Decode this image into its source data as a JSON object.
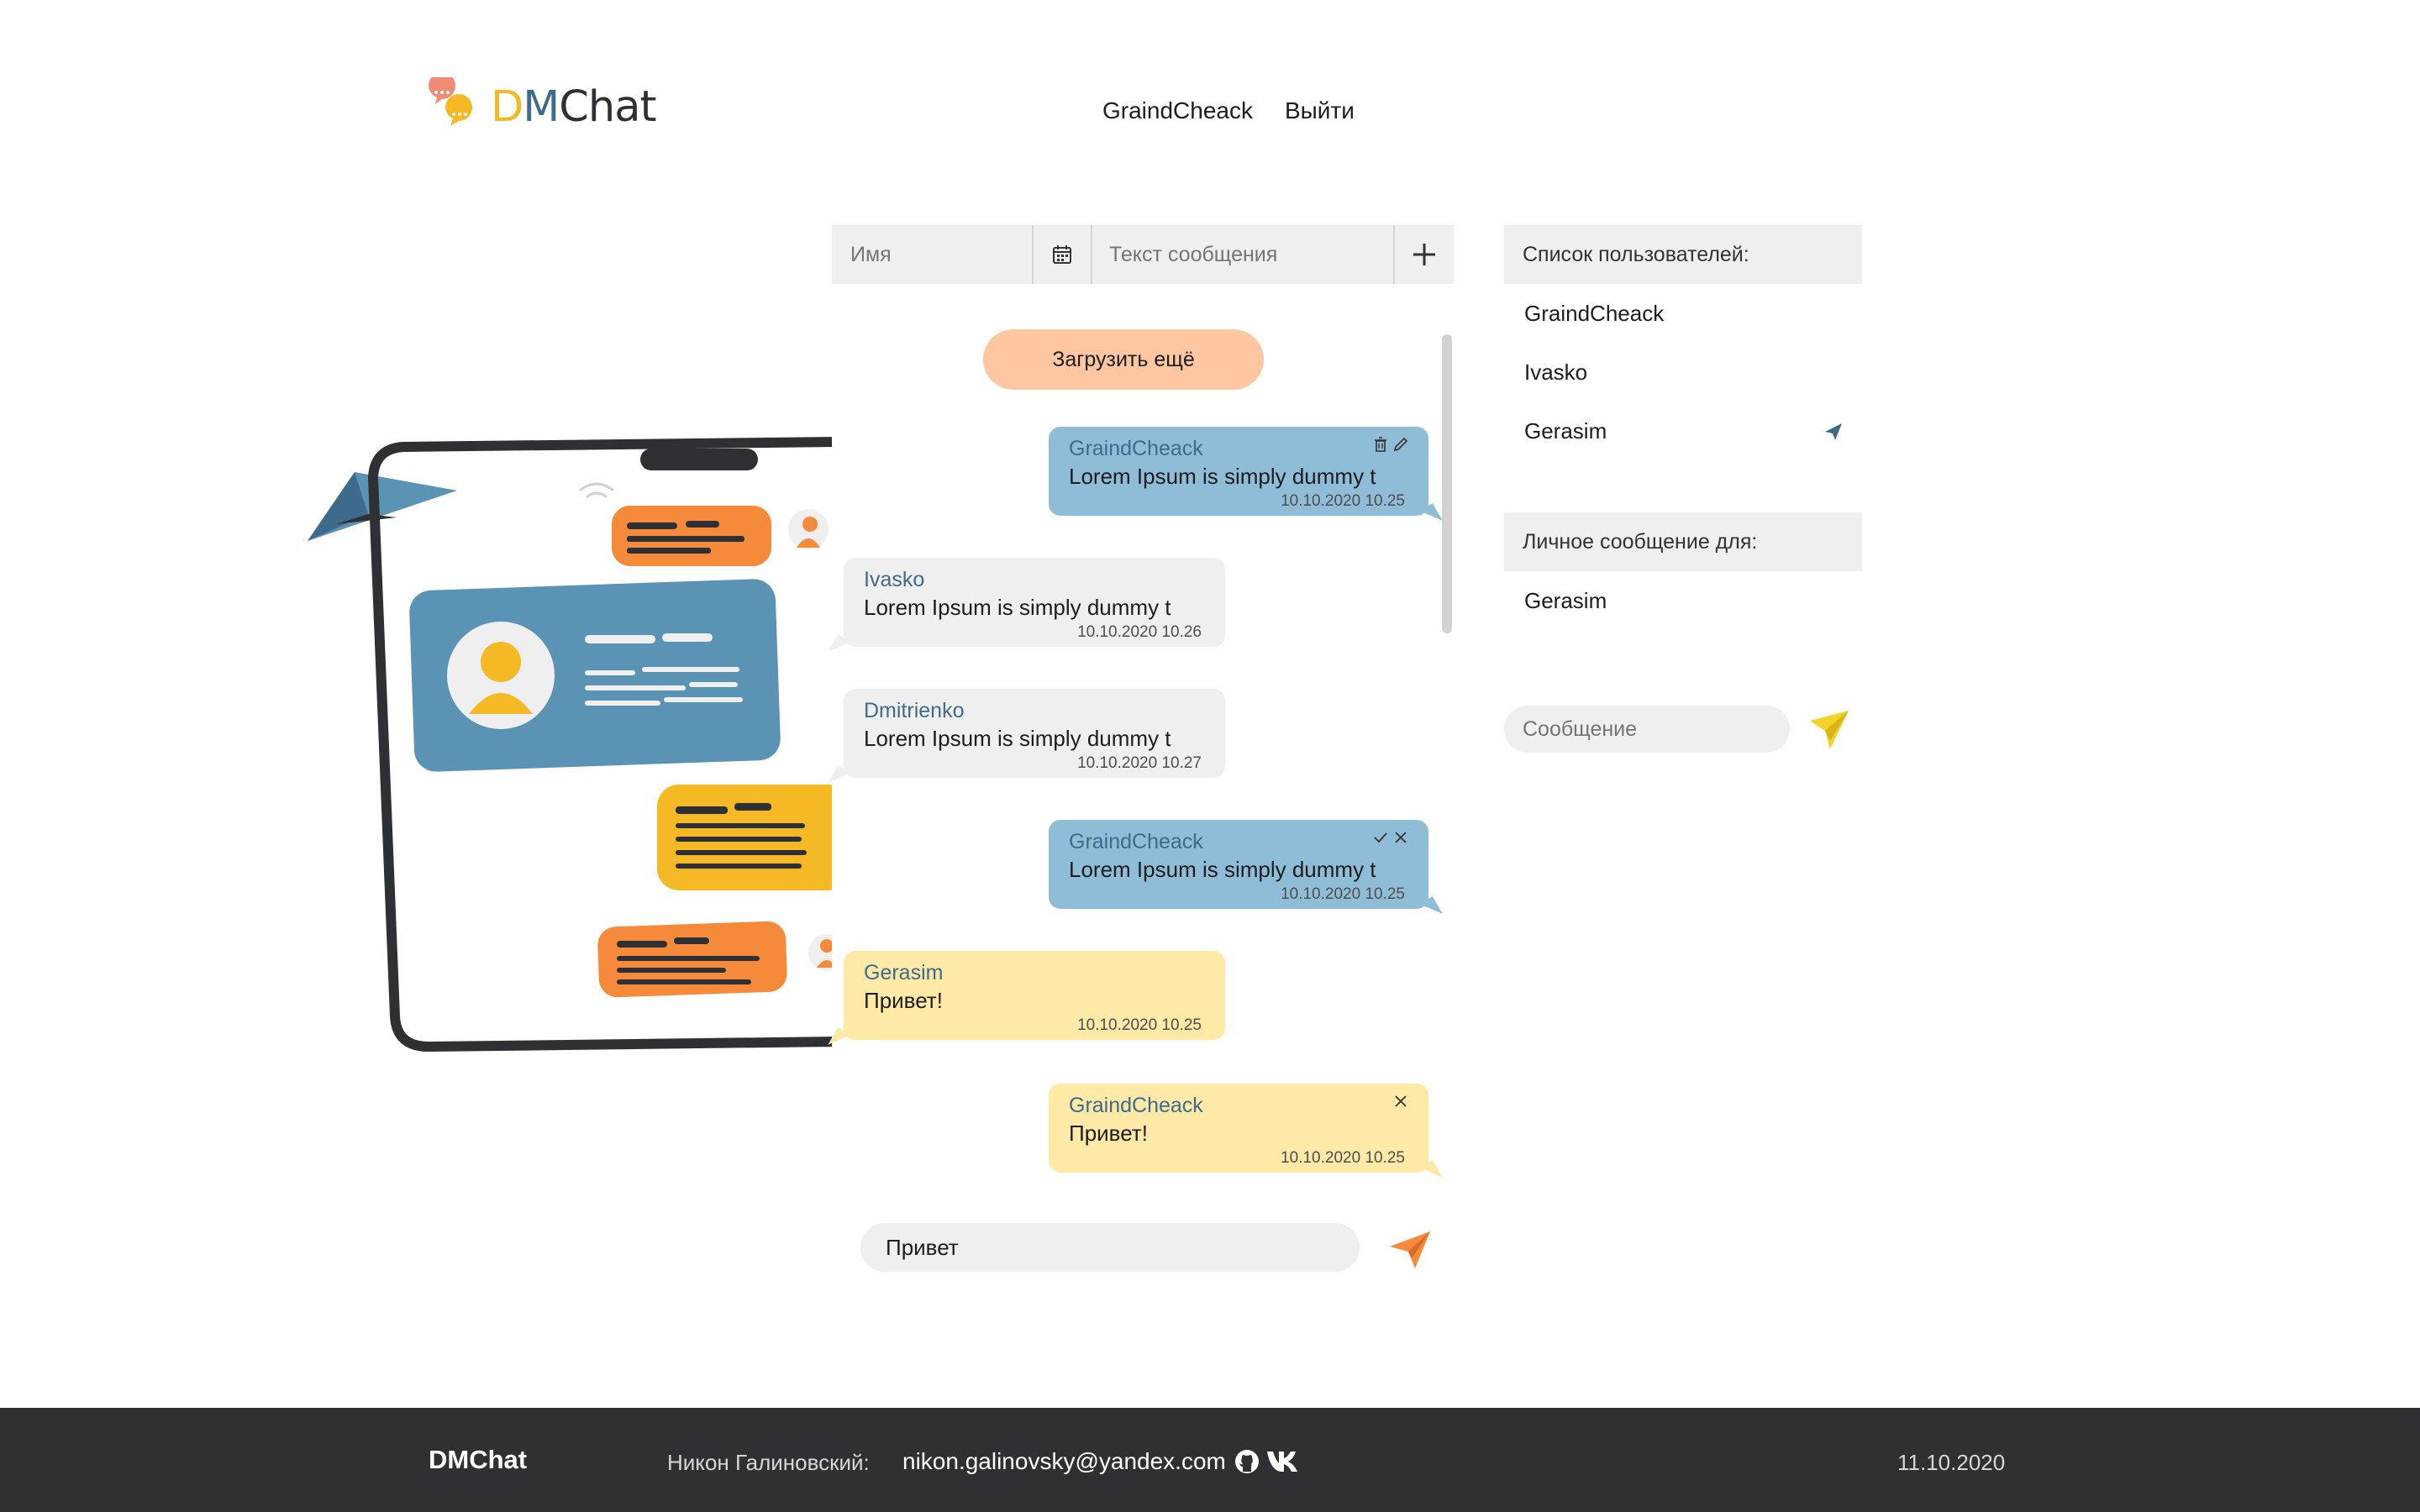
{
  "app": {
    "logo": {
      "d": "D",
      "m": "M",
      "rest": "Chat"
    }
  },
  "header": {
    "username": "GraindCheack",
    "logout_label": "Выйти"
  },
  "filter": {
    "name_placeholder": "Имя",
    "text_placeholder": "Текст сообщения",
    "add_icon": "plus-icon",
    "calendar_icon": "calendar-icon"
  },
  "chat": {
    "load_more_label": "Загрузить ещё",
    "messages": [
      {
        "author": "GraindCheack",
        "text": "Lorem Ipsum is simply dummy t",
        "time": "10.10.2020 10.25",
        "own": true,
        "style": "blue",
        "actions": "delete-edit"
      },
      {
        "author": "Ivasko",
        "text": "Lorem Ipsum is simply dummy t",
        "time": "10.10.2020 10.26",
        "own": false,
        "style": "gray"
      },
      {
        "author": "Dmitrienko",
        "text": "Lorem Ipsum is simply dummy t",
        "time": "10.10.2020 10.27",
        "own": false,
        "style": "gray"
      },
      {
        "author": "GraindCheack",
        "text": "Lorem Ipsum is simply dummy t",
        "time": "10.10.2020 10.25",
        "own": true,
        "style": "blue",
        "actions": "confirm-cancel"
      },
      {
        "author": "Gerasim",
        "text": "Привет!",
        "time": "10.10.2020 10.25",
        "own": false,
        "style": "yellow"
      },
      {
        "author": "GraindCheack",
        "text": "Привет!",
        "time": "10.10.2020 10.25",
        "own": true,
        "style": "yellow",
        "actions": "cancel"
      }
    ],
    "composer_value": "Привет"
  },
  "sidebar": {
    "users_title": "Список пользователей:",
    "users": [
      "GraindCheack",
      "Ivasko",
      "Gerasim"
    ],
    "pm_title": "Личное сообщение для:",
    "pm_recipient": "Gerasim",
    "pm_placeholder": "Сообщение"
  },
  "footer": {
    "brand": "DMChat",
    "author_label": "Никон Галиновский:",
    "email": "nikon.galinovsky@yandex.com",
    "date": "11.10.2020"
  },
  "colors": {
    "accent_blue": "#8fbcd7",
    "accent_yellow": "#ffe9a6",
    "accent_orange": "#ffc7a1",
    "footer_bg": "#2f3034",
    "author_color": "#3e6b8c"
  }
}
